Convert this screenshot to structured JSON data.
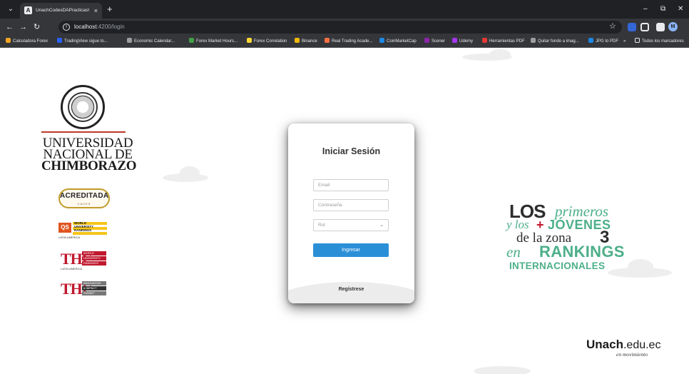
{
  "browser": {
    "tab_title": "UnachCodesDAPracticasWeb",
    "tab_favicon": "A",
    "tab_close": "×",
    "new_tab": "+",
    "url_host": "localhost",
    "url_path": ":4200/login",
    "profile_initial": "M",
    "window_minimize": "–",
    "window_restore": "⧉",
    "window_close": "✕"
  },
  "bookmarks": [
    {
      "label": "Calculadora Forex",
      "color": "#f5a623"
    },
    {
      "label": "TradingView sigue to...",
      "color": "#2962ff"
    },
    {
      "label": "Economic Calendar...",
      "color": "#9e9e9e"
    },
    {
      "label": "Forex Market Hours...",
      "color": "#43a047"
    },
    {
      "label": "Forex Correlation",
      "color": "#fdd835"
    },
    {
      "label": "Binance",
      "color": "#f0b90b"
    },
    {
      "label": "Real Trading Acade...",
      "color": "#ff7043"
    },
    {
      "label": "CoinMarketCap",
      "color": "#1e88e5"
    },
    {
      "label": "Scener",
      "color": "#8e24aa"
    },
    {
      "label": "Udemy",
      "color": "#a435f0"
    },
    {
      "label": "Herramientas PDF",
      "color": "#e53935"
    },
    {
      "label": "Quitar fondo a imag...",
      "color": "#9e9e9e"
    },
    {
      "label": "JPG to PDF",
      "color": "#1e88e5"
    }
  ],
  "bookmarks_overflow": "»",
  "bookmarks_folder": "Todos los marcadores",
  "left_brand": {
    "university_lines": [
      "UNIVERSIDAD",
      "NACIONAL DE",
      "CHIMBORAZO"
    ],
    "acreditada": "ACREDITADA",
    "acreditada_sub": "CACES",
    "qs_mark": "QS",
    "qs_text": [
      "WORLD",
      "UNIVERSITY",
      "RANKINGS"
    ],
    "qs_sub": "LATIN AMERICA",
    "the_letters": "THE",
    "the_rankings_1": [
      "WORLD",
      "UNIVERSITY",
      "RANKINGS"
    ],
    "the_rankings_1_sub": "LATIN AMERICA",
    "the_rankings_2": [
      "INNOVATION",
      "& IMPACT",
      "SUMMIT"
    ]
  },
  "login": {
    "title": "Iniciar Sesión",
    "email_placeholder": "Email",
    "password_placeholder": "Contraseña",
    "role_placeholder": "Rol",
    "submit_label": "Ingresar",
    "register_label": "Regístrese"
  },
  "slogan": {
    "los": "LOS",
    "primeros": "primeros",
    "ylos": "y los",
    "plus": "+",
    "jovenes": "JÓVENES",
    "zona": "de la zona",
    "zona_num": "3",
    "en": "en",
    "rankings": "RANKINGS",
    "internacionales": "INTERNACIONALES"
  },
  "footer_logo": {
    "unach": "Unach",
    "domain": ".edu.ec",
    "tagline": "en movimiento"
  }
}
